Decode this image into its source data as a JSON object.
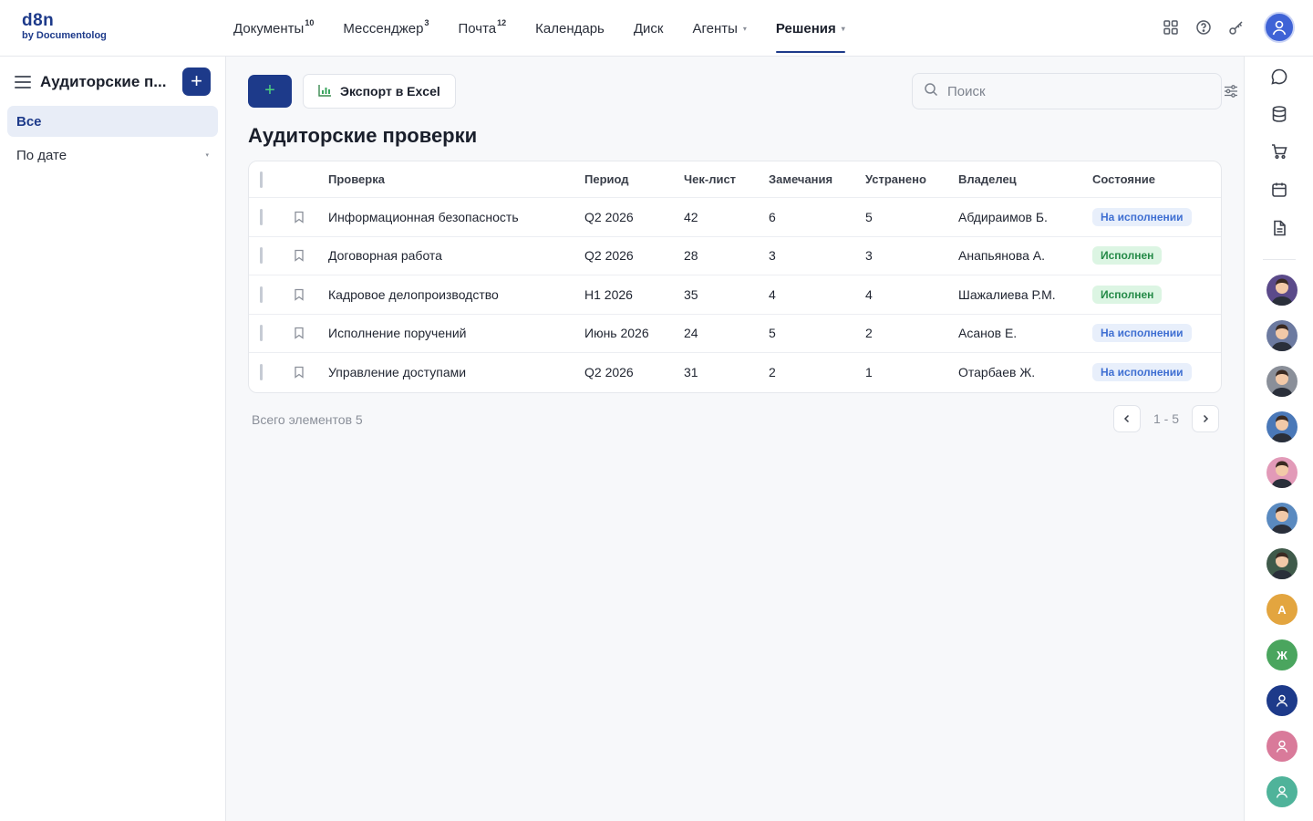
{
  "logo": {
    "line1": "d8n",
    "line2": "by Documentolog"
  },
  "nav": [
    {
      "label": "Документы",
      "badge": "10"
    },
    {
      "label": "Мессенджер",
      "badge": "3"
    },
    {
      "label": "Почта",
      "badge": "12"
    },
    {
      "label": "Календарь",
      "badge": ""
    },
    {
      "label": "Диск",
      "badge": ""
    },
    {
      "label": "Агенты",
      "badge": "",
      "caret": "▾"
    },
    {
      "label": "Решения",
      "badge": "",
      "caret": "▾",
      "active": true
    }
  ],
  "top_icons": [
    "apps-grid-icon",
    "help-icon",
    "key-icon",
    "user-avatar"
  ],
  "sidebar": {
    "title": "Аудиторские п...",
    "add_label": "+",
    "items": [
      {
        "label": "Все",
        "active": true
      },
      {
        "label": "По дате",
        "caret": "▾"
      }
    ]
  },
  "toolbar": {
    "add_label": "+",
    "export_label": "Экспорт в Excel",
    "search_placeholder": "Поиск"
  },
  "page_title": "Аудиторские проверки",
  "table": {
    "headers": [
      "Проверка",
      "Период",
      "Чек-лист",
      "Замечания",
      "Устранено",
      "Владелец",
      "Состояние"
    ],
    "rows": [
      {
        "name": "Информационная безопасность",
        "period": "Q2 2026",
        "checklist": "42",
        "remarks": "6",
        "fixed": "5",
        "owner": "Абдираимов Б.",
        "state": "На исполнении",
        "state_kind": "prog"
      },
      {
        "name": "Договорная работа",
        "period": "Q2 2026",
        "checklist": "28",
        "remarks": "3",
        "fixed": "3",
        "owner": "Анапьянова А.",
        "state": "Исполнен",
        "state_kind": "done"
      },
      {
        "name": "Кадровое делопроизводство",
        "period": "H1 2026",
        "checklist": "35",
        "remarks": "4",
        "fixed": "4",
        "owner": "Шажалиева Р.М.",
        "state": "Исполнен",
        "state_kind": "done"
      },
      {
        "name": "Исполнение поручений",
        "period": "Июнь 2026",
        "checklist": "24",
        "remarks": "5",
        "fixed": "2",
        "owner": "Асанов Е.",
        "state": "На исполнении",
        "state_kind": "prog"
      },
      {
        "name": "Управление доступами",
        "period": "Q2 2026",
        "checklist": "31",
        "remarks": "2",
        "fixed": "1",
        "owner": "Отарбаев Ж.",
        "state": "На исполнении",
        "state_kind": "prog"
      }
    ]
  },
  "footer": {
    "total": "Всего элементов 5",
    "range": "1 - 5"
  },
  "rail": {
    "icons": [
      "chat-icon",
      "database-icon",
      "cart-icon",
      "calendar-icon",
      "document-icon"
    ],
    "avatars": [
      {
        "kind": "photo",
        "color": "#5b4a8a"
      },
      {
        "kind": "photo",
        "color": "#6c7aa0"
      },
      {
        "kind": "photo",
        "color": "#8a8f99"
      },
      {
        "kind": "photo",
        "color": "#4a78b8"
      },
      {
        "kind": "photo",
        "color": "#e29ab8"
      },
      {
        "kind": "photo",
        "color": "#5a8ac0"
      },
      {
        "kind": "photo",
        "color": "#3f5a4a"
      },
      {
        "kind": "letter",
        "letter": "А",
        "color": "#e3a53f"
      },
      {
        "kind": "letter",
        "letter": "Ж",
        "color": "#4aa55e"
      },
      {
        "kind": "user",
        "color": "#1d3a8a"
      },
      {
        "kind": "user",
        "color": "#d97a9a"
      },
      {
        "kind": "user",
        "color": "#4fb39a"
      }
    ]
  }
}
